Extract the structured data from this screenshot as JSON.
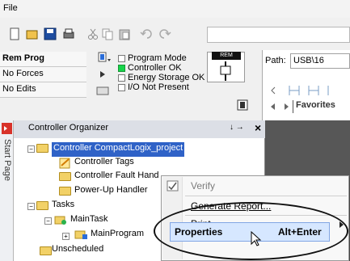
{
  "menubar": {
    "file": "File"
  },
  "status": {
    "rem_prog": "Rem Prog",
    "no_forces": "No Forces",
    "no_edits": "No Edits",
    "program_mode": "Program Mode",
    "controller_ok": "Controller OK",
    "energy_storage_ok": "Energy Storage OK",
    "io_not_present": "I/O Not Present",
    "keyswitch_label": "REM"
  },
  "path": {
    "label": "Path:",
    "value": "USB\\16"
  },
  "favorites": "Favorites",
  "organizer": {
    "title": "Controller Organizer",
    "side_tab": "Start Page",
    "pin": "↓ →",
    "close": "×",
    "tree": {
      "controller": "Controller CompactLogix_project",
      "controller_tags": "Controller Tags",
      "fault_handler": "Controller Fault Hand",
      "powerup_handler": "Power-Up Handler",
      "tasks": "Tasks",
      "main_task": "MainTask",
      "main_program": "MainProgram",
      "unscheduled": "Unscheduled"
    }
  },
  "context_menu": {
    "verify": "Verify",
    "generate_report": "Generate Report...",
    "print": "Print",
    "properties": "Properties",
    "properties_shortcut": "Alt+Enter"
  },
  "colors": {
    "selection": "#2f62c7",
    "highlight": "#d6e7ff",
    "controller_ok_indicator": "#16d44a"
  }
}
